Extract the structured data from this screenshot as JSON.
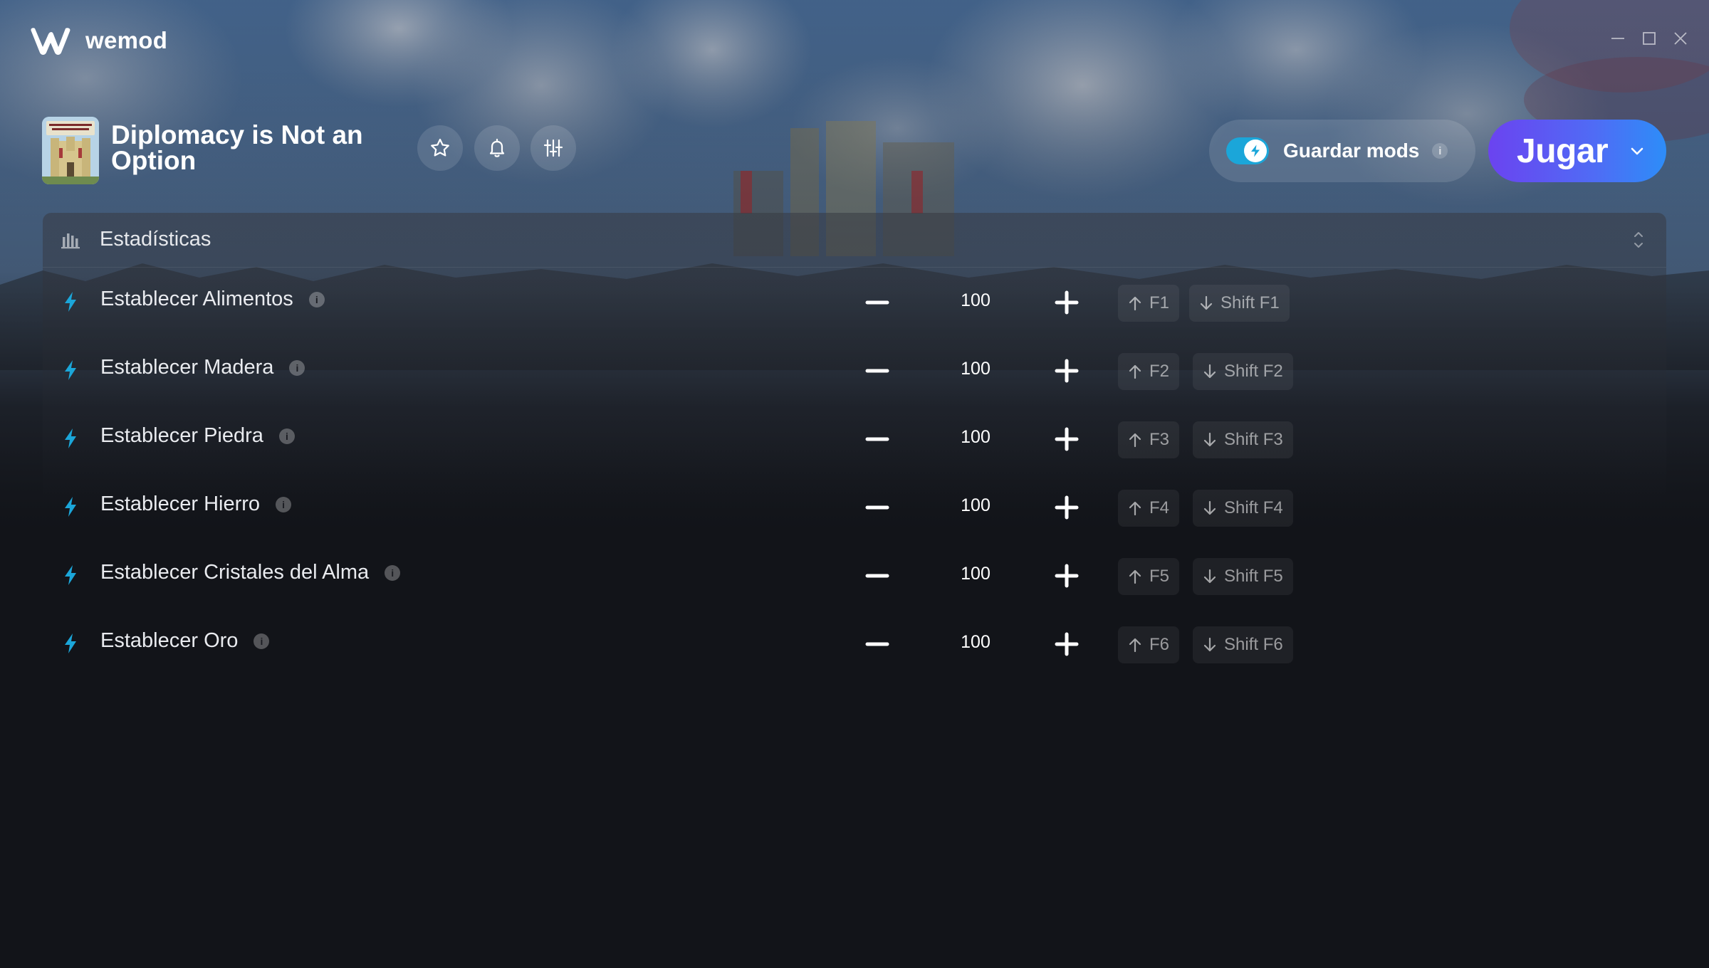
{
  "app": {
    "brand": "wemod"
  },
  "window_controls": [
    "minimize-icon",
    "maximize-icon",
    "close-icon"
  ],
  "game": {
    "title": "Diplomacy is Not an Option",
    "thumbnail_icon": "game-cover-image",
    "actions": [
      "favorite-star-icon",
      "notification-bell-icon",
      "settings-sliders-icon"
    ]
  },
  "save_mods": {
    "label": "Guardar mods",
    "enabled": true,
    "info": "i"
  },
  "play": {
    "label": "Jugar"
  },
  "stats": {
    "title": "Estadísticas"
  },
  "mods": [
    {
      "name": "Establecer Alimentos",
      "value": "100",
      "inc_key": "F1",
      "dec_key": "Shift F1"
    },
    {
      "name": "Establecer Madera",
      "value": "100",
      "inc_key": "F2",
      "dec_key": "Shift F2"
    },
    {
      "name": "Establecer Piedra",
      "value": "100",
      "inc_key": "F3",
      "dec_key": "Shift F3"
    },
    {
      "name": "Establecer Hierro",
      "value": "100",
      "inc_key": "F4",
      "dec_key": "Shift F4"
    },
    {
      "name": "Establecer Cristales del Alma",
      "value": "100",
      "inc_key": "F5",
      "dec_key": "Shift F5"
    },
    {
      "name": "Establecer Oro",
      "value": "100",
      "inc_key": "F6",
      "dec_key": "Shift F6"
    }
  ],
  "colors": {
    "background": "#121419",
    "accent_cyan": "#1ba6d9",
    "play_gradient_start": "#6b43f0",
    "play_gradient_end": "#2d8df8"
  }
}
